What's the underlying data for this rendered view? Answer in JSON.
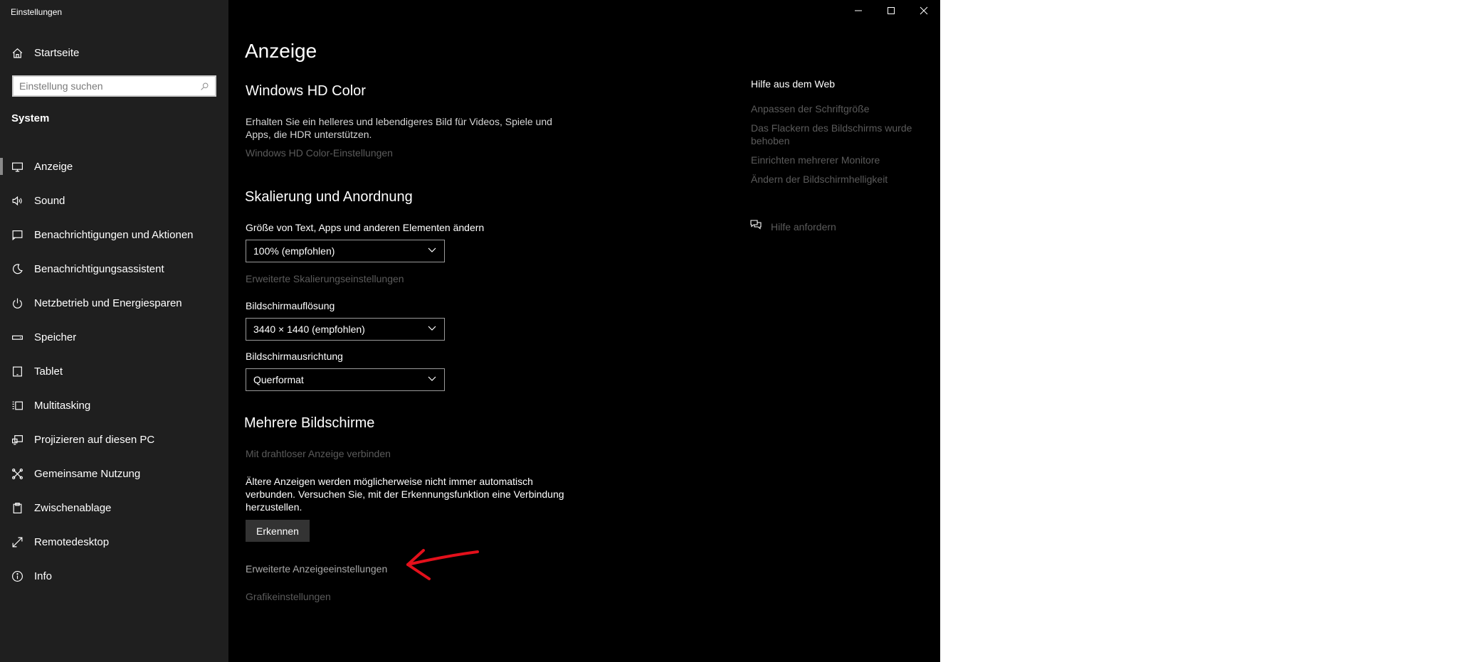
{
  "window": {
    "app_title": "Einstellungen",
    "controls": {
      "minimize": "minimize-icon",
      "maximize": "maximize-icon",
      "close": "close-icon"
    }
  },
  "sidebar": {
    "home_label": "Startseite",
    "search": {
      "placeholder": "Einstellung suchen",
      "value": ""
    },
    "section": "System",
    "items": [
      {
        "label": "Anzeige",
        "icon": "monitor-icon",
        "selected": true
      },
      {
        "label": "Sound",
        "icon": "speaker-icon"
      },
      {
        "label": "Benachrichtigungen und Aktionen",
        "icon": "notification-icon"
      },
      {
        "label": "Benachrichtigungsassistent",
        "icon": "moon-icon"
      },
      {
        "label": "Netzbetrieb und Energiesparen",
        "icon": "power-icon"
      },
      {
        "label": "Speicher",
        "icon": "storage-icon"
      },
      {
        "label": "Tablet",
        "icon": "tablet-icon"
      },
      {
        "label": "Multitasking",
        "icon": "multitasking-icon"
      },
      {
        "label": "Projizieren auf diesen PC",
        "icon": "project-icon"
      },
      {
        "label": "Gemeinsame Nutzung",
        "icon": "share-icon"
      },
      {
        "label": "Zwischenablage",
        "icon": "clipboard-icon"
      },
      {
        "label": "Remotedesktop",
        "icon": "remote-desktop-icon"
      },
      {
        "label": "Info",
        "icon": "info-icon"
      }
    ]
  },
  "main": {
    "title": "Anzeige",
    "hdr": {
      "heading": "Windows HD Color",
      "description": "Erhalten Sie ein helleres und lebendigeres Bild für Videos, Spiele und Apps, die HDR unterstützen.",
      "link": "Windows HD Color-Einstellungen"
    },
    "scaling": {
      "heading": "Skalierung und Anordnung",
      "size_label": "Größe von Text, Apps und anderen Elementen ändern",
      "size_value": "100% (empfohlen)",
      "advanced_link": "Erweiterte Skalierungseinstellungen",
      "resolution_label": "Bildschirmauflösung",
      "resolution_value": "3440 × 1440 (empfohlen)",
      "orientation_label": "Bildschirmausrichtung",
      "orientation_value": "Querformat"
    },
    "multi": {
      "heading": "Mehrere Bildschirme",
      "wireless_link": "Mit drahtloser Anzeige verbinden",
      "description": "Ältere Anzeigen werden möglicherweise nicht immer automatisch verbunden. Versuchen Sie, mit der Erkennungsfunktion eine Verbindung herzustellen.",
      "detect_button": "Erkennen"
    },
    "advanced_display_link": "Erweiterte Anzeigeeinstellungen",
    "graphics_link": "Grafikeinstellungen"
  },
  "help": {
    "heading": "Hilfe aus dem Web",
    "links": [
      "Anpassen der Schriftgröße",
      "Das Flackern des Bildschirms wurde behoben",
      "Einrichten mehrerer Monitore",
      "Ändern der Bildschirmhelligkeit"
    ],
    "request": "Hilfe anfordern"
  },
  "colors": {
    "window_bg": "#000000",
    "sidebar_bg": "#1f1f1f",
    "annotation_arrow": "#e3101b"
  }
}
